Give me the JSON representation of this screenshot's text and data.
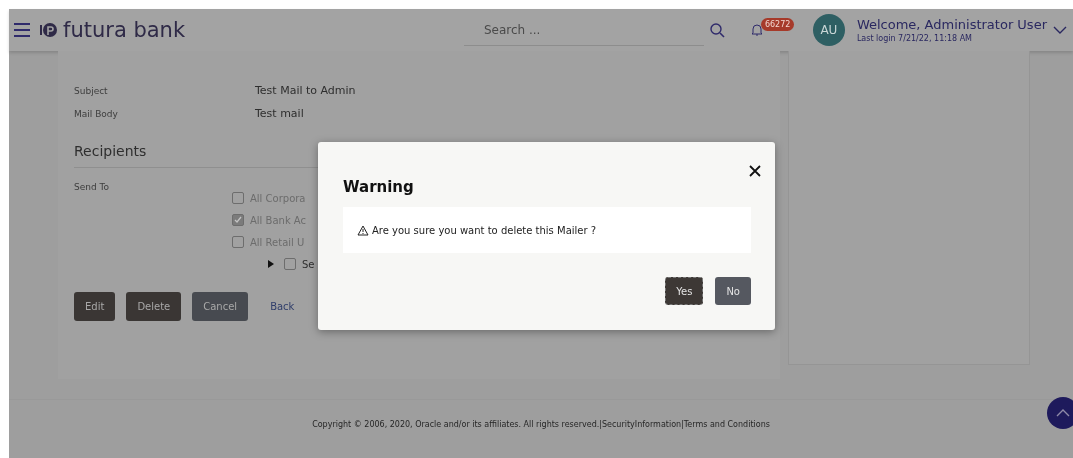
{
  "header": {
    "brand": "futura bank",
    "search": {
      "placeholder": "Search ..."
    },
    "notifications": "66272",
    "avatar": "AU",
    "welcome": "Welcome, Administrator User",
    "last_login": "Last login 7/21/22, 11:18 AM"
  },
  "details": [
    {
      "label": "Subject",
      "value": "Test Mail to Admin"
    },
    {
      "label": "Mail Body",
      "value": "Test mail"
    }
  ],
  "recipients": {
    "title": "Recipients",
    "label": "Send To",
    "options": [
      {
        "label": "All Corpora",
        "checked": false
      },
      {
        "label": "All Bank Ac",
        "checked": true
      },
      {
        "label": "All Retail U",
        "checked": false
      }
    ],
    "segment": {
      "label": "Se",
      "checked": false,
      "expanded": false
    }
  },
  "actions": [
    {
      "label": "Edit",
      "kind": "dark"
    },
    {
      "label": "Delete",
      "kind": "dark"
    },
    {
      "label": "Cancel",
      "kind": "slate"
    },
    {
      "label": "Back",
      "kind": "link"
    }
  ],
  "dialog": {
    "title": "Warning",
    "message": "Are you sure you want to delete this Mailer ?",
    "buttons": [
      {
        "label": "Yes",
        "focused": true
      },
      {
        "label": "No",
        "focused": false
      }
    ]
  },
  "footer": {
    "copyright": "Copyright © 2006, 2020, Oracle and/or its affiliates. All rights reserved.|",
    "links": [
      "SecurityInformation",
      "|Terms and Conditions"
    ]
  }
}
